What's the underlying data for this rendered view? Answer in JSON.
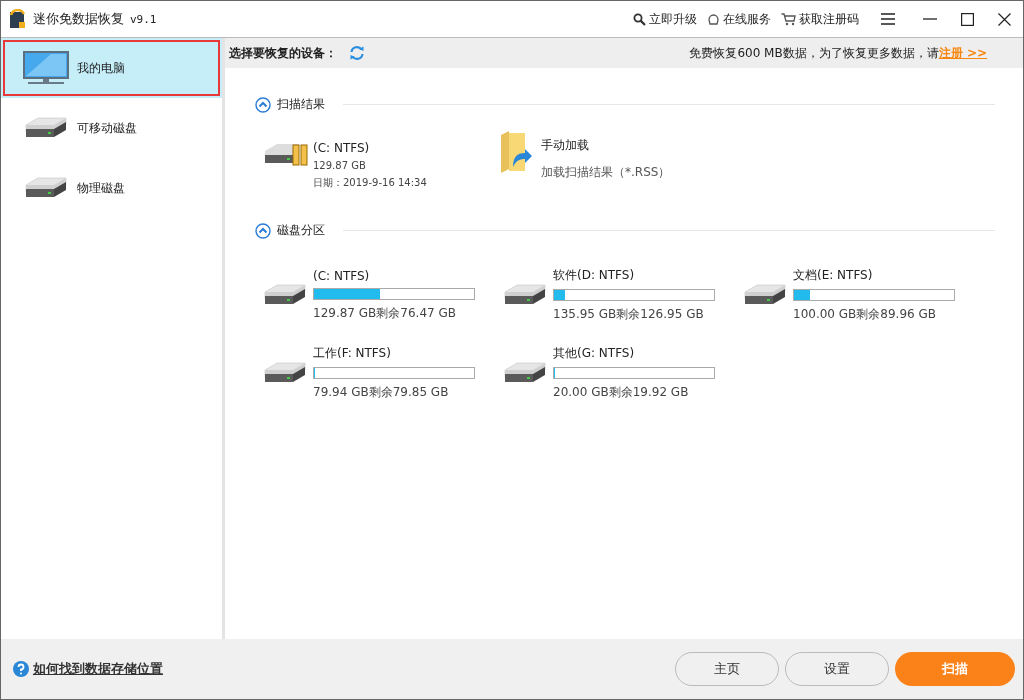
{
  "window": {
    "title": "迷你免数据恢复",
    "version": "v9.1"
  },
  "title_actions": [
    {
      "label": "立即升级",
      "kind": "upgrade"
    },
    {
      "label": "在线服务",
      "kind": "service"
    },
    {
      "label": "获取注册码",
      "kind": "cart"
    }
  ],
  "sidebar": {
    "items": [
      {
        "label": "我的电脑",
        "kind": "computer",
        "selected": true
      },
      {
        "label": "可移动磁盘",
        "kind": "removable",
        "selected": false
      },
      {
        "label": "物理磁盘",
        "kind": "physical",
        "selected": false
      }
    ]
  },
  "header": {
    "label": "选择要恢复的设备：",
    "notice": "免费恢复600 MB数据，为了恢复更多数据，请",
    "link": "注册 >>"
  },
  "scan_results": {
    "title": "扫描结果",
    "expanded": true,
    "items": [
      {
        "name": "(C: NTFS)",
        "size": "129.87 GB",
        "date": "日期：2019-9-16 14:34"
      }
    ],
    "manual_load": {
      "title": "手动加载",
      "subtitle": "加载扫描结果（*.RSS）"
    }
  },
  "partitions": {
    "title": "磁盘分区",
    "expanded": true,
    "items": [
      {
        "name": "(C: NTFS)",
        "level": 0.41,
        "usage": "129.87 GB剩余76.47 GB"
      },
      {
        "name": "软件(D: NTFS)",
        "level": 0.066,
        "usage": "135.95 GB剩余126.95 GB"
      },
      {
        "name": "文档(E: NTFS)",
        "level": 0.1,
        "usage": "100.00 GB剩余89.96 GB"
      },
      {
        "name": "工作(F: NTFS)",
        "level": 0.001,
        "usage": "79.94 GB剩余79.85 GB"
      },
      {
        "name": "其他(G: NTFS)",
        "level": 0.004,
        "usage": "20.00 GB剩余19.92 GB"
      }
    ]
  },
  "footer": {
    "help_link": "如何找到数据存储位置",
    "buttons": [
      {
        "label": "主页",
        "kind": "normal"
      },
      {
        "label": "设置",
        "kind": "normal"
      },
      {
        "label": "扫描",
        "kind": "primary"
      }
    ]
  }
}
